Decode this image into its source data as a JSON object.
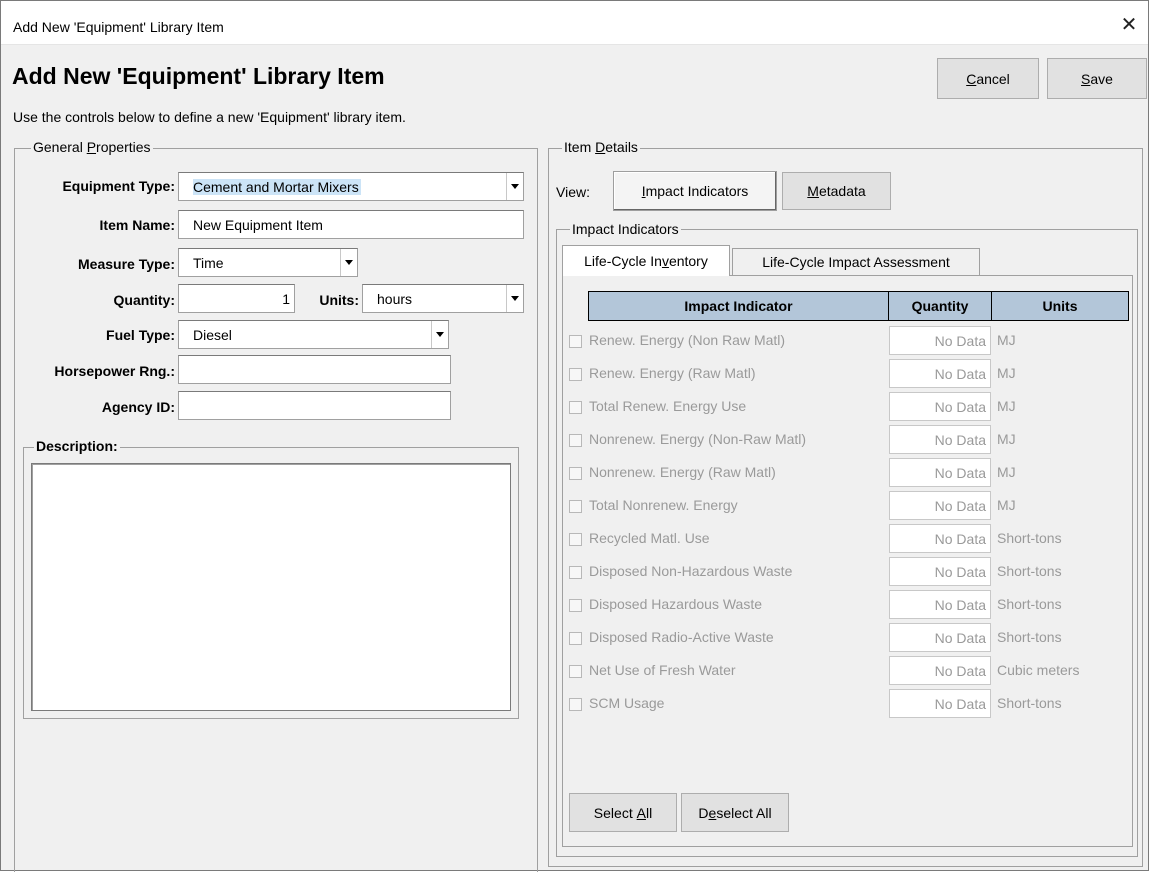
{
  "window": {
    "title": "Add New 'Equipment' Library Item",
    "close_glyph": "✕"
  },
  "header": {
    "title": "Add New 'Equipment' Library Item",
    "instructions": "Use the controls below to define a new 'Equipment' library item."
  },
  "actions": {
    "cancel": {
      "accel": "C",
      "rest": "ancel"
    },
    "save": {
      "accel": "S",
      "rest": "ave"
    }
  },
  "general": {
    "legend_pre": "General ",
    "legend_accel": "P",
    "legend_post": "roperties",
    "equipment_type_label": "Equipment Type:",
    "equipment_type_value": "Cement and Mortar Mixers",
    "item_name_label": "Item Name:",
    "item_name_value": "New Equipment Item",
    "measure_type_label": "Measure Type:",
    "measure_type_value": "Time",
    "quantity_label": "Quantity:",
    "quantity_value": "1",
    "units_label": "Units:",
    "units_value": "hours",
    "fuel_type_label": "Fuel Type:",
    "fuel_type_value": "Diesel",
    "horsepower_label": "Horsepower Rng.:",
    "horsepower_value": "",
    "agency_id_label": "Agency ID:",
    "agency_id_value": "",
    "description_label": "Description:",
    "description_value": ""
  },
  "details": {
    "legend_pre": "Item ",
    "legend_accel": "D",
    "legend_post": "etails",
    "view_label": "View:",
    "view_impact": {
      "accel": "I",
      "rest": "mpact Indicators"
    },
    "view_metadata": {
      "accel": "M",
      "rest": "etadata"
    },
    "impact_legend": "Impact Indicators",
    "tabs": [
      {
        "pre": "Life-Cycle In",
        "accel": "v",
        "post": "entory"
      },
      {
        "pre": "Life-Cycle Impact Assessment",
        "accel": "",
        "post": ""
      }
    ],
    "columns": [
      "Impact Indicator",
      "Quantity",
      "Units"
    ],
    "rows": [
      {
        "label": "Renew. Energy (Non Raw Matl)",
        "qty": "No Data",
        "units": "MJ"
      },
      {
        "label": "Renew. Energy (Raw Matl)",
        "qty": "No Data",
        "units": "MJ"
      },
      {
        "label": "Total Renew. Energy Use",
        "qty": "No Data",
        "units": "MJ"
      },
      {
        "label": "Nonrenew. Energy (Non-Raw Matl)",
        "qty": "No Data",
        "units": "MJ"
      },
      {
        "label": "Nonrenew. Energy (Raw Matl)",
        "qty": "No Data",
        "units": "MJ"
      },
      {
        "label": "Total Nonrenew. Energy",
        "qty": "No Data",
        "units": "MJ"
      },
      {
        "label": "Recycled Matl. Use",
        "qty": "No Data",
        "units": "Short-tons"
      },
      {
        "label": "Disposed Non-Hazardous Waste",
        "qty": "No Data",
        "units": "Short-tons"
      },
      {
        "label": "Disposed Hazardous Waste",
        "qty": "No Data",
        "units": "Short-tons"
      },
      {
        "label": "Disposed Radio-Active Waste",
        "qty": "No Data",
        "units": "Short-tons"
      },
      {
        "label": "Net Use of Fresh Water",
        "qty": "No Data",
        "units": "Cubic meters"
      },
      {
        "label": "SCM Usage",
        "qty": "No Data",
        "units": "Short-tons"
      }
    ],
    "select_all": {
      "pre": "Select ",
      "accel": "A",
      "post": "ll"
    },
    "deselect_all": {
      "pre": "D",
      "accel": "e",
      "post": "select All"
    }
  }
}
